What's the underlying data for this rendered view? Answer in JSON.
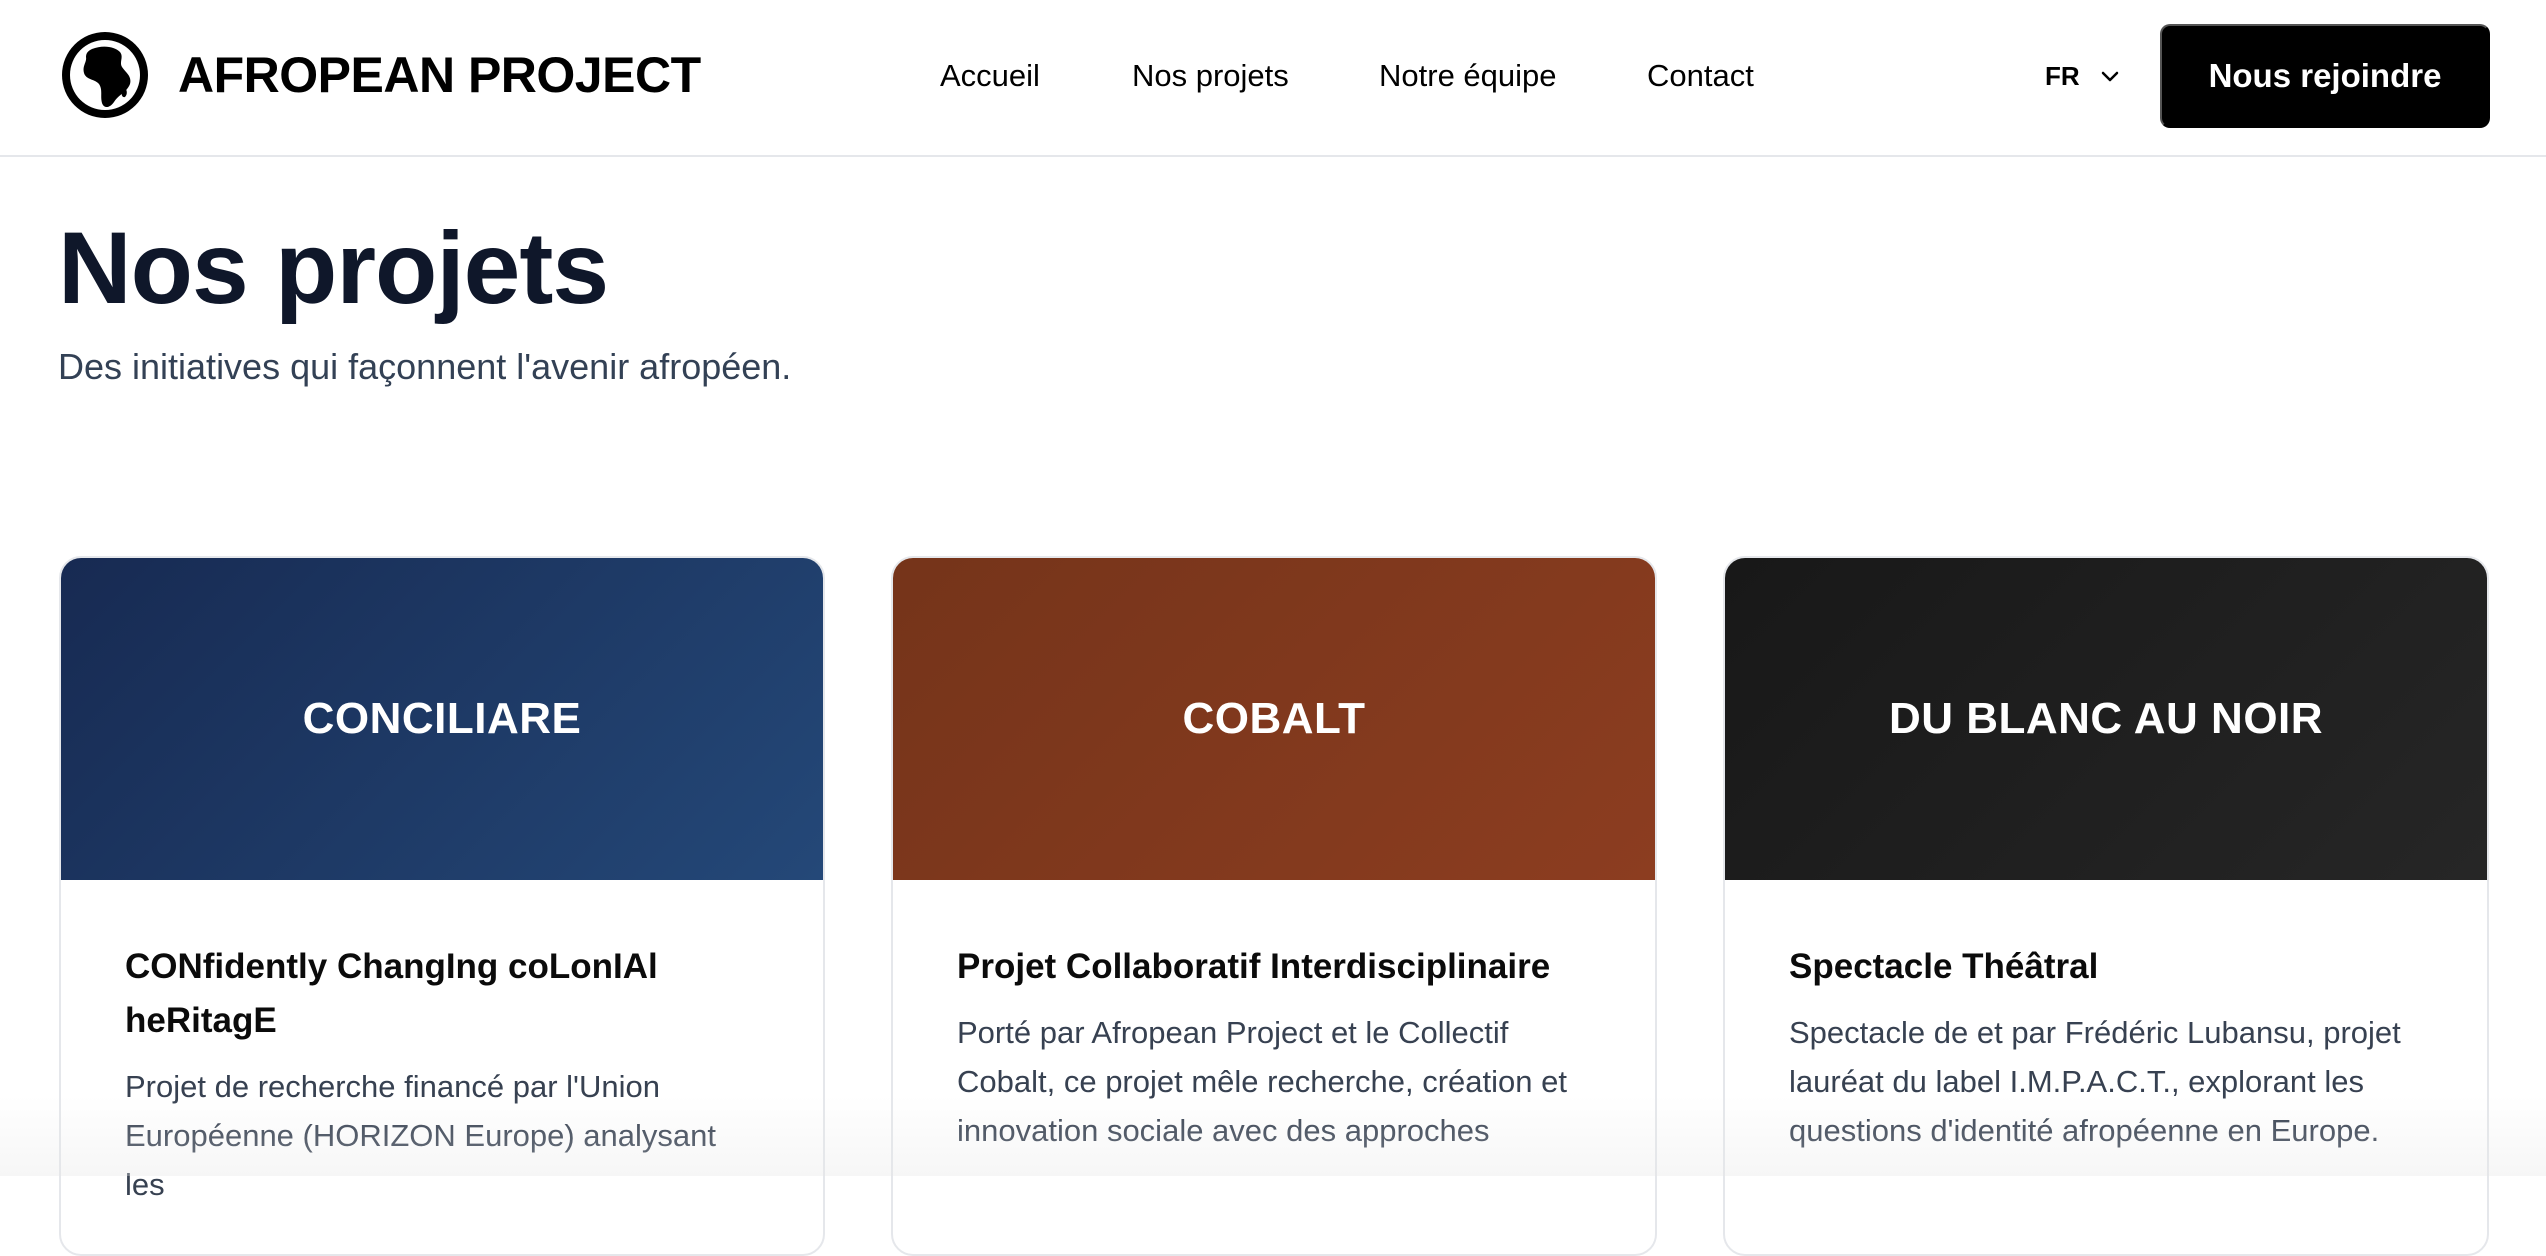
{
  "header": {
    "logo_icon": "globe-africa-icon",
    "logo_text": "AFROPEAN PROJECT",
    "nav": [
      {
        "label": "Accueil"
      },
      {
        "label": "Nos projets"
      },
      {
        "label": "Notre équipe"
      },
      {
        "label": "Contact"
      }
    ],
    "language": {
      "selected": "FR",
      "icon": "chevron-down-icon"
    },
    "cta_label": "Nous rejoindre"
  },
  "main": {
    "title": "Nos projets",
    "subtitle": "Des initiatives qui façonnent l'avenir afropéen."
  },
  "projects": [
    {
      "banner_title": "CONCILIARE",
      "subtitle": "CONfidently ChangIng coLonIAl heRitagE",
      "description": "Projet de recherche financé par l'Union Européenne (HORIZON Europe) analysant les",
      "color_start": "#172a52",
      "color_end": "#244878"
    },
    {
      "banner_title": "COBALT",
      "subtitle": "Projet Collaboratif Interdisciplinaire",
      "description": "Porté par Afropean Project et le Collectif Cobalt, ce projet mêle recherche, création et innovation sociale avec des approches",
      "color_start": "#75341a",
      "color_end": "#8c3d20"
    },
    {
      "banner_title": "DU BLANC AU NOIR",
      "subtitle": "Spectacle Théâtral",
      "description": "Spectacle de et par Frédéric Lubansu, projet lauréat du label I.M.P.A.C.T., explorant les questions d'identité afropéenne en Europe.",
      "color_start": "#181818",
      "color_end": "#262626"
    }
  ],
  "colors": {
    "cta_background": "#000000",
    "title_text": "#0f172a",
    "subtitle_text": "#334155"
  }
}
